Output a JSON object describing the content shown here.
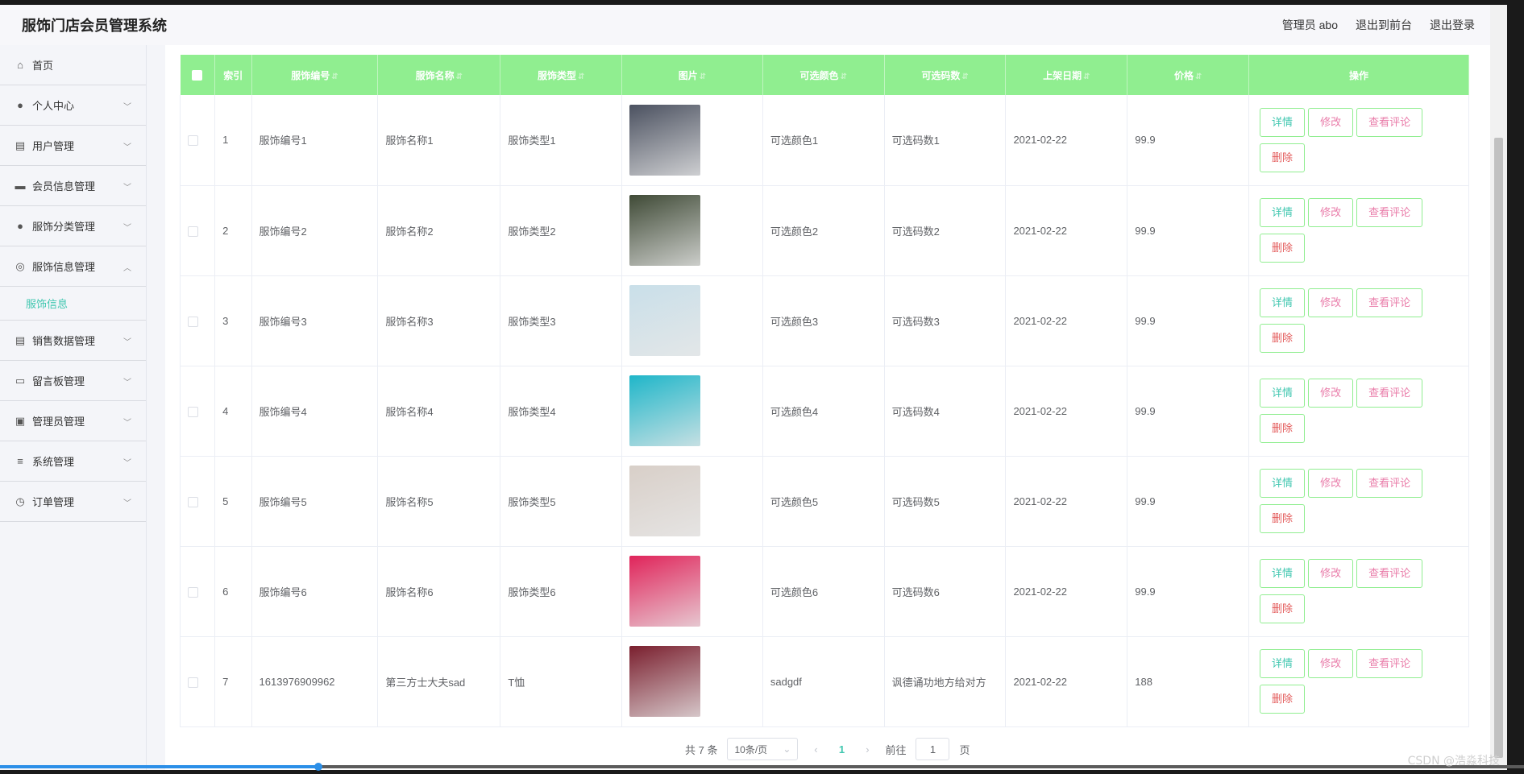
{
  "header": {
    "title": "服饰门店会员管理系统",
    "admin_label": "管理员 abo",
    "to_front": "退出到前台",
    "logout": "退出登录"
  },
  "sidebar": {
    "items": [
      {
        "label": "首页",
        "icon": "home-icon"
      },
      {
        "label": "个人中心",
        "icon": "user-icon"
      },
      {
        "label": "用户管理",
        "icon": "clipboard-icon"
      },
      {
        "label": "会员信息管理",
        "icon": "chat-icon"
      },
      {
        "label": "服饰分类管理",
        "icon": "user-icon"
      },
      {
        "label": "服饰信息管理",
        "icon": "circle-icon",
        "sub": "服饰信息"
      },
      {
        "label": "销售数据管理",
        "icon": "clipboard-icon"
      },
      {
        "label": "留言板管理",
        "icon": "briefcase-icon"
      },
      {
        "label": "管理员管理",
        "icon": "card-icon"
      },
      {
        "label": "系统管理",
        "icon": "sliders-icon"
      },
      {
        "label": "订单管理",
        "icon": "clock-icon"
      }
    ]
  },
  "table": {
    "columns": [
      "索引",
      "服饰编号",
      "服饰名称",
      "服饰类型",
      "图片",
      "可选颜色",
      "可选码数",
      "上架日期",
      "价格",
      "操作"
    ],
    "rows": [
      {
        "idx": "1",
        "code": "服饰编号1",
        "name": "服饰名称1",
        "type": "服饰类型1",
        "img": "#4b5160",
        "color": "可选颜色1",
        "size": "可选码数1",
        "date": "2021-02-22",
        "price": "99.9"
      },
      {
        "idx": "2",
        "code": "服饰编号2",
        "name": "服饰名称2",
        "type": "服饰类型2",
        "img": "#3f4a36",
        "color": "可选颜色2",
        "size": "可选码数2",
        "date": "2021-02-22",
        "price": "99.9"
      },
      {
        "idx": "3",
        "code": "服饰编号3",
        "name": "服饰名称3",
        "type": "服饰类型3",
        "img": "#c9dfe9",
        "color": "可选颜色3",
        "size": "可选码数3",
        "date": "2021-02-22",
        "price": "99.9"
      },
      {
        "idx": "4",
        "code": "服饰编号4",
        "name": "服饰名称4",
        "type": "服饰类型4",
        "img": "#1fb6c9",
        "color": "可选颜色4",
        "size": "可选码数4",
        "date": "2021-02-22",
        "price": "99.9"
      },
      {
        "idx": "5",
        "code": "服饰编号5",
        "name": "服饰名称5",
        "type": "服饰类型5",
        "img": "#d8cfc8",
        "color": "可选颜色5",
        "size": "可选码数5",
        "date": "2021-02-22",
        "price": "99.9"
      },
      {
        "idx": "6",
        "code": "服饰编号6",
        "name": "服饰名称6",
        "type": "服饰类型6",
        "img": "#e0245a",
        "color": "可选颜色6",
        "size": "可选码数6",
        "date": "2021-02-22",
        "price": "99.9"
      },
      {
        "idx": "7",
        "code": "1613976909962",
        "name": "第三方士大夫sad",
        "type": "T恤",
        "img": "#7a1f2e",
        "color": "sadgdf",
        "size": "讽德诵功地方给对方",
        "date": "2021-02-22",
        "price": "188"
      }
    ],
    "actions": {
      "detail": "详情",
      "edit": "修改",
      "comment": "查看评论",
      "delete": "删除"
    }
  },
  "pagination": {
    "total": "共 7 条",
    "page_size": "10条/页",
    "current": "1",
    "goto_prefix": "前往",
    "goto_value": "1",
    "goto_suffix": "页"
  },
  "watermark": "CSDN @浩淼科技"
}
